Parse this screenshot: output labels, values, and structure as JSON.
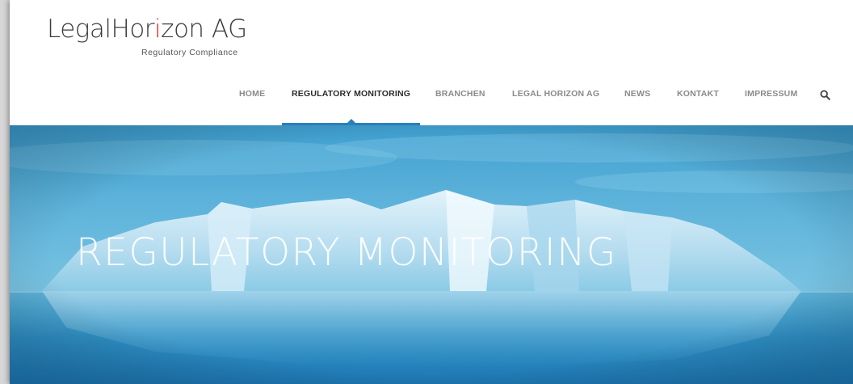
{
  "logo": {
    "name_part1": "LegalHor",
    "name_part2": "i",
    "name_part3": "zon AG",
    "tagline": "Regulatory Compliance",
    "accent_color": "#d9302c"
  },
  "nav": {
    "items": [
      {
        "label": "HOME",
        "active": false
      },
      {
        "label": "REGULATORY MONITORING",
        "active": true
      },
      {
        "label": "BRANCHEN",
        "active": false
      },
      {
        "label": "LEGAL HORIZON AG",
        "active": false
      },
      {
        "label": "NEWS",
        "active": false
      },
      {
        "label": "KONTAKT",
        "active": false
      },
      {
        "label": "IMPRESSUM",
        "active": false
      }
    ],
    "search_icon": "search-icon",
    "active_color": "#2a7fb8"
  },
  "hero": {
    "title": "REGULATORY MONITORING",
    "background": "iceberg-image"
  }
}
